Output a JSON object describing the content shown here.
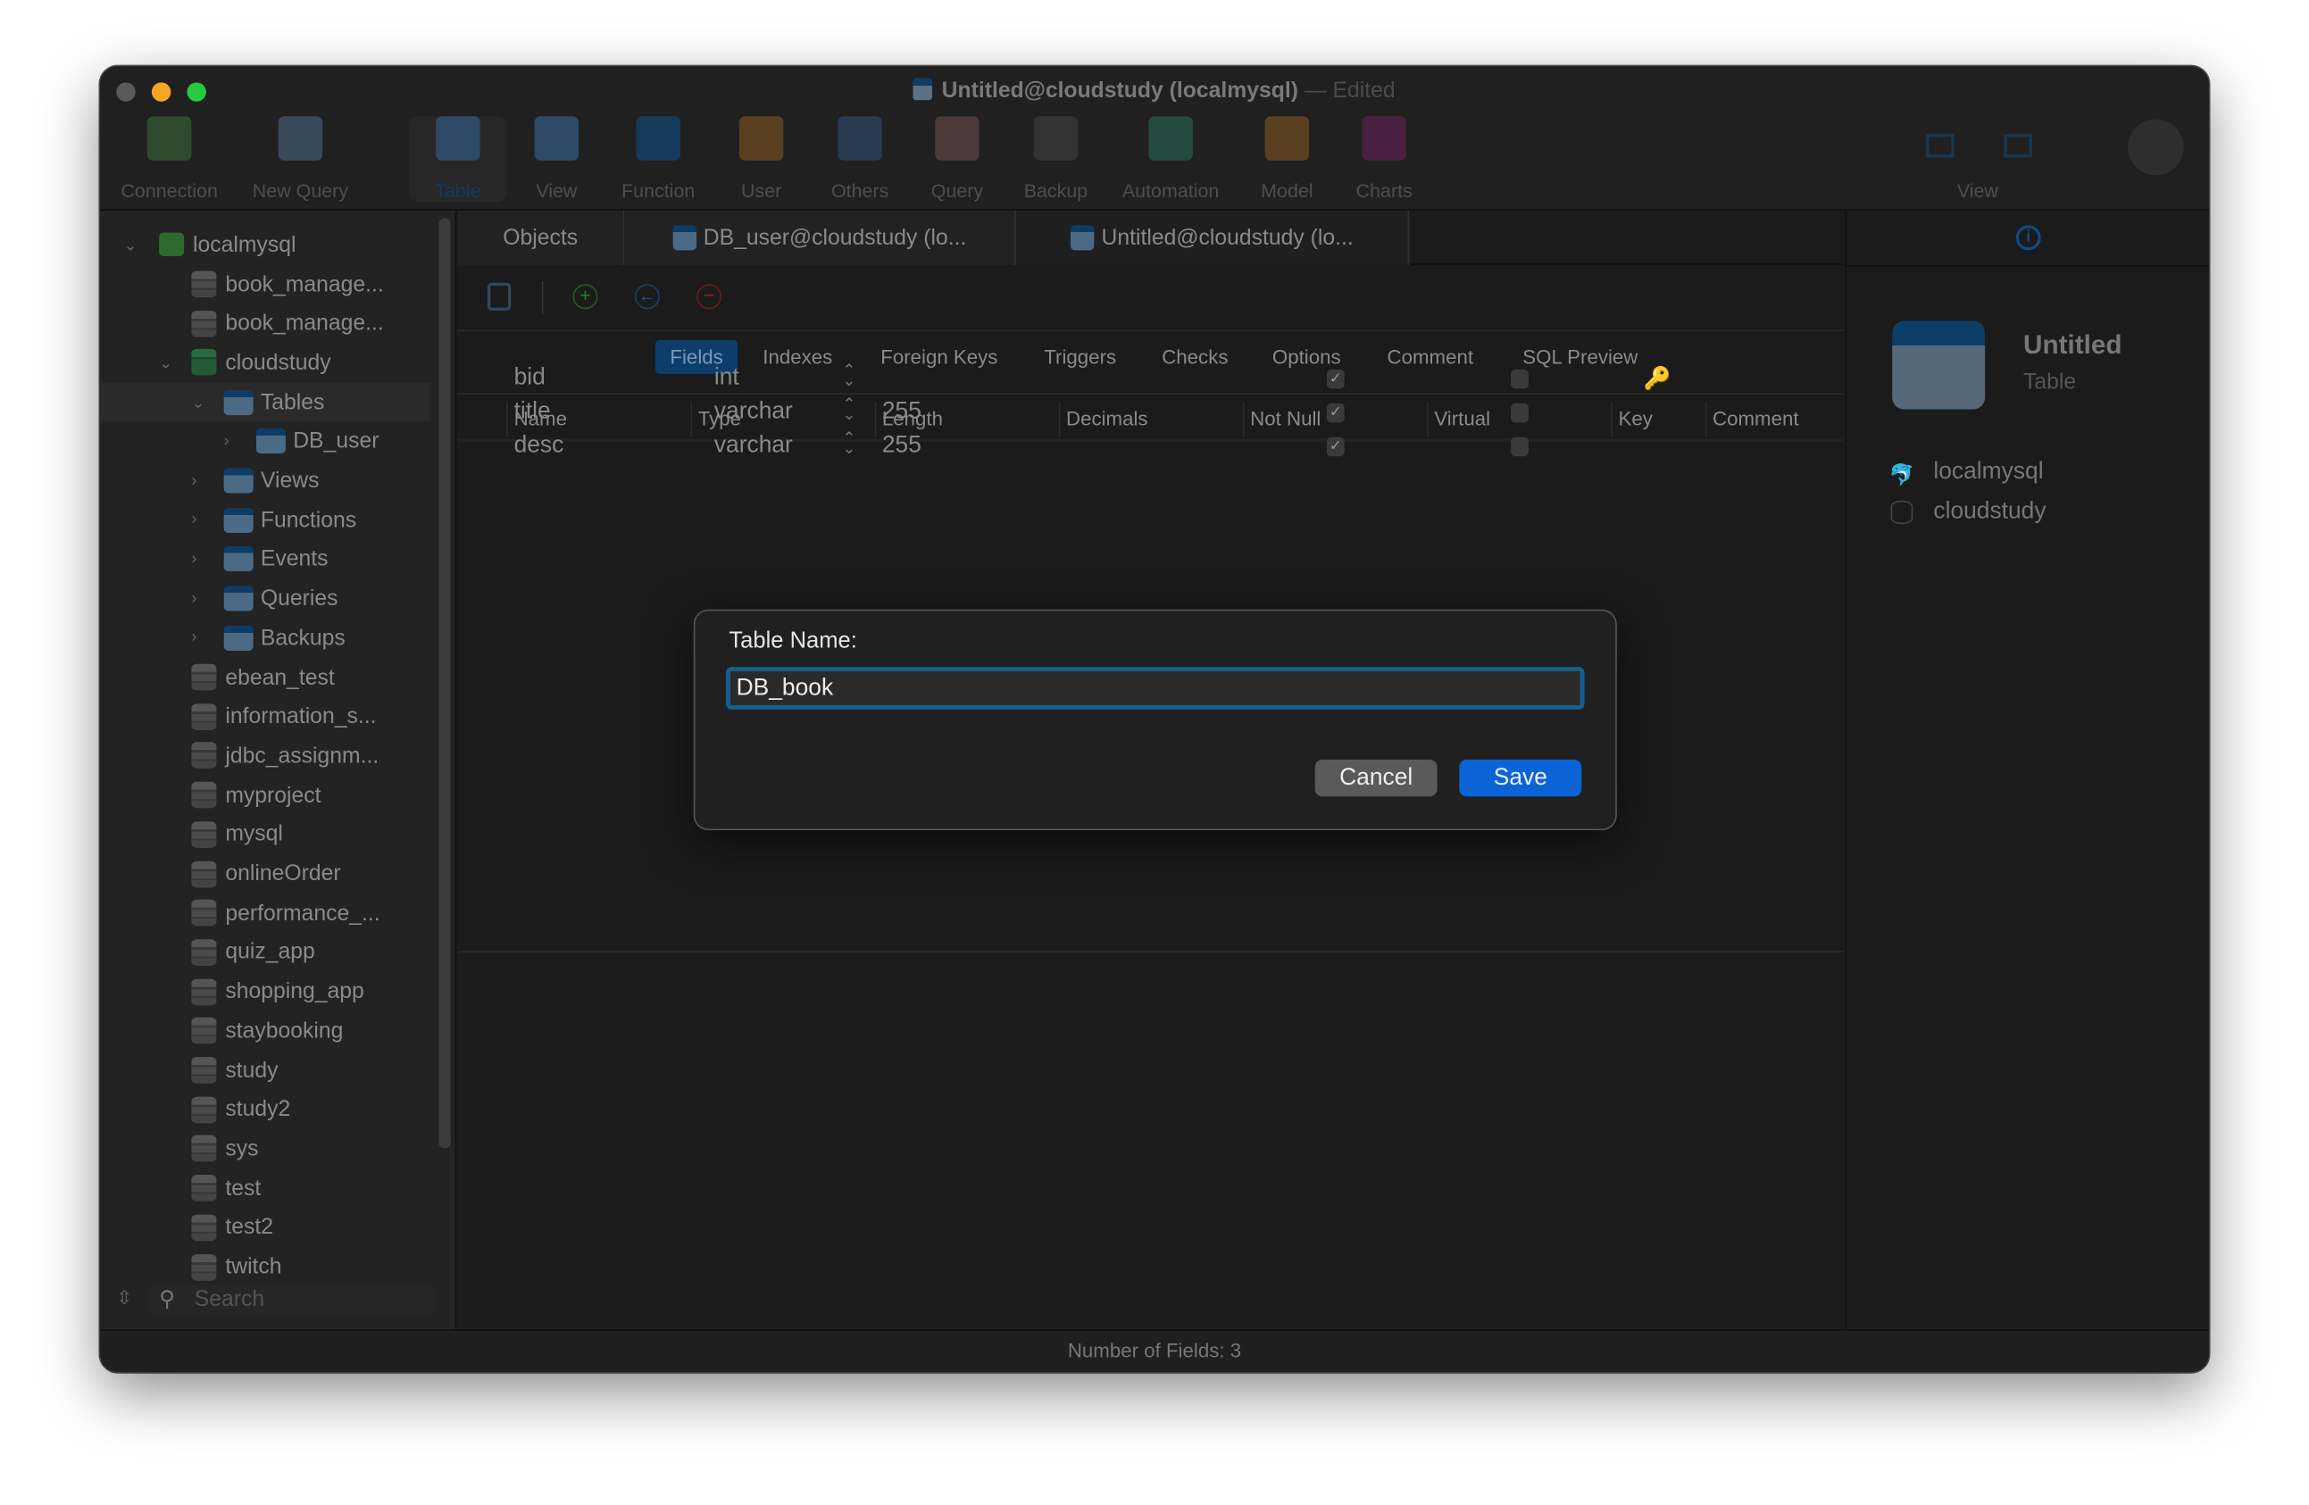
{
  "window": {
    "title": "Untitled@cloudstudy (localmysql)",
    "title_suffix": "— Edited"
  },
  "toolbar": {
    "items": [
      {
        "label": "Connection",
        "icon": "connection-icon"
      },
      {
        "label": "New Query",
        "icon": "new-query-icon"
      },
      {
        "label": "Table",
        "icon": "table-icon",
        "active": true
      },
      {
        "label": "View",
        "icon": "view-icon"
      },
      {
        "label": "Function",
        "icon": "function-icon"
      },
      {
        "label": "User",
        "icon": "user-icon"
      },
      {
        "label": "Others",
        "icon": "others-icon"
      },
      {
        "label": "Query",
        "icon": "query-icon"
      },
      {
        "label": "Backup",
        "icon": "backup-icon"
      },
      {
        "label": "Automation",
        "icon": "automation-icon"
      },
      {
        "label": "Model",
        "icon": "model-icon"
      },
      {
        "label": "Charts",
        "icon": "charts-icon"
      }
    ],
    "view_label": "View"
  },
  "sidebar": {
    "connection": "localmysql",
    "items": [
      "book_manage...",
      "book_manage...",
      "cloudstudy",
      "Tables",
      "DB_user",
      "Views",
      "Functions",
      "Events",
      "Queries",
      "Backups",
      "ebean_test",
      "information_s...",
      "jdbc_assignm...",
      "myproject",
      "mysql",
      "onlineOrder",
      "performance_...",
      "quiz_app",
      "shopping_app",
      "staybooking",
      "study",
      "study2",
      "sys",
      "test",
      "test2",
      "twitch"
    ],
    "search_placeholder": "Search"
  },
  "tabs": [
    "Objects",
    "DB_user@cloudstudy (lo...",
    "Untitled@cloudstudy (lo..."
  ],
  "subtabs": [
    "Fields",
    "Indexes",
    "Foreign Keys",
    "Triggers",
    "Checks",
    "Options",
    "Comment",
    "SQL Preview"
  ],
  "columns": [
    "Name",
    "Type",
    "Length",
    "Decimals",
    "Not Null",
    "Virtual",
    "Key",
    "Comment"
  ],
  "rows": [
    {
      "name": "bid",
      "type": "int",
      "length": "",
      "not_null": true,
      "virtual": false,
      "key": true
    },
    {
      "name": "title",
      "type": "varchar",
      "length": "255",
      "not_null": true,
      "virtual": false,
      "key": false
    },
    {
      "name": "desc",
      "type": "varchar",
      "length": "255",
      "not_null": true,
      "virtual": false,
      "key": false
    }
  ],
  "info": {
    "name": "Untitled",
    "kind": "Table",
    "connection": "localmysql",
    "database": "cloudstudy"
  },
  "status": "Number of Fields: 3",
  "dialog": {
    "label": "Table Name:",
    "value": "DB_book",
    "cancel": "Cancel",
    "save": "Save"
  },
  "colors": {
    "accent": "#0a64d6",
    "focus_ring": "#14608f",
    "key": "#b07a22"
  }
}
